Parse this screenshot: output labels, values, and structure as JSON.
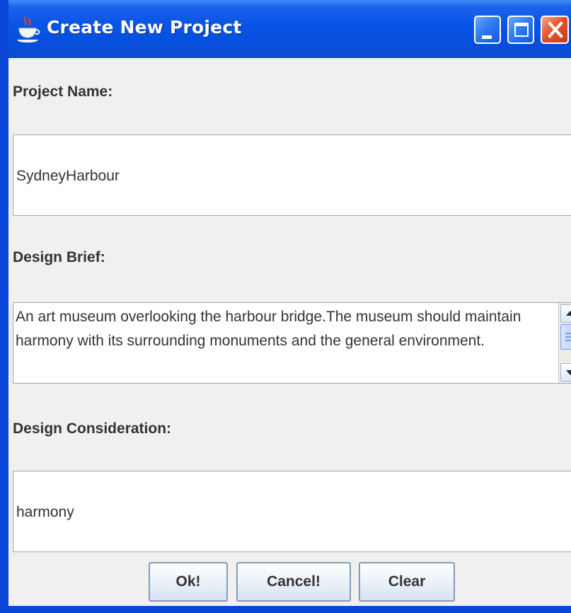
{
  "window": {
    "title": "Create New Project",
    "icon": "java-cup-icon",
    "controls": [
      "minimize-icon",
      "maximize-icon",
      "close-icon"
    ]
  },
  "form": {
    "project_name": {
      "label": "Project Name:",
      "value": "SydneyHarbour"
    },
    "design_brief": {
      "label": "Design Brief:",
      "value": "An art museum overlooking the harbour bridge.The museum should maintain harmony with its surrounding monuments and the general environment."
    },
    "design_consideration": {
      "label": "Design Consideration:",
      "value": "harmony"
    }
  },
  "buttons": {
    "ok": "Ok!",
    "cancel": "Cancel!",
    "clear": "Clear"
  },
  "colors": {
    "titlebar": "#0a55e6",
    "close_button": "#e4542c",
    "content_background": "#f0f0f0",
    "text": "#333333"
  }
}
